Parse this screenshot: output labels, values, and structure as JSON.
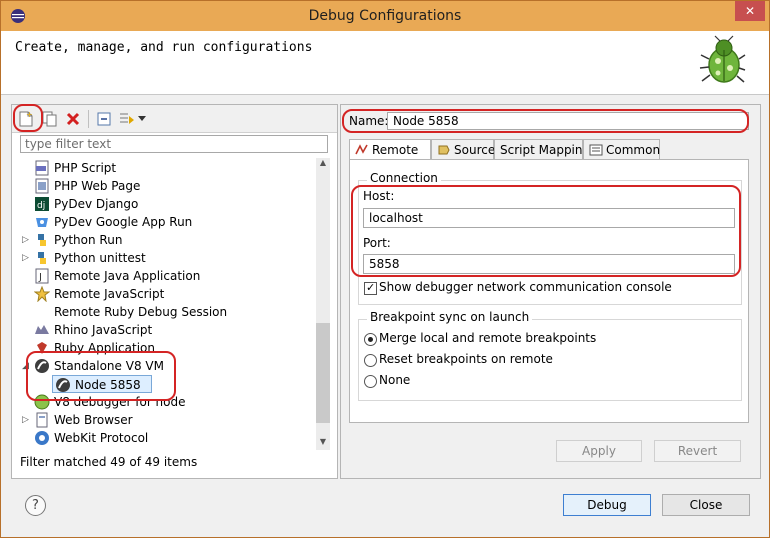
{
  "window": {
    "title": "Debug Configurations",
    "close_glyph": "✕"
  },
  "header": {
    "text": "Create, manage, and run configurations",
    "icon": "bug-icon"
  },
  "toolbar": {
    "buttons": [
      "new-configuration-icon",
      "duplicate-icon",
      "delete-icon",
      "collapse-all-icon",
      "filter-icon",
      "dropdown-icon"
    ]
  },
  "filter": {
    "placeholder": "type filter text"
  },
  "tree": {
    "items": [
      {
        "label": "PHP Script",
        "icon": "php-icon"
      },
      {
        "label": "PHP Web Page",
        "icon": "php-page-icon"
      },
      {
        "label": "PyDev Django",
        "icon": "django-icon"
      },
      {
        "label": "PyDev Google App Run",
        "icon": "gae-icon"
      },
      {
        "label": "Python Run",
        "icon": "python-icon"
      },
      {
        "label": "Python unittest",
        "icon": "python-icon"
      },
      {
        "label": "Remote Java Application",
        "icon": "java-icon"
      },
      {
        "label": "Remote JavaScript",
        "icon": "js-icon"
      },
      {
        "label": "Remote Ruby Debug Session",
        "icon": "ruby-icon"
      },
      {
        "label": "Rhino JavaScript",
        "icon": "rhino-icon"
      },
      {
        "label": "Ruby Application",
        "icon": "ruby-icon"
      },
      {
        "label": "Standalone V8 VM",
        "icon": "v8-icon"
      },
      {
        "label": "Node 5858",
        "icon": "node-icon"
      },
      {
        "label": "V8 debugger for node",
        "icon": "v8-node-icon"
      },
      {
        "label": "Web Browser",
        "icon": "browser-icon"
      },
      {
        "label": "WebKit Protocol",
        "icon": "webkit-icon"
      }
    ]
  },
  "status": "Filter matched 49 of 49 items",
  "name": {
    "label": "Name:",
    "value": "Node 5858"
  },
  "tabs": [
    "Remote",
    "Source",
    "Script Mapping",
    "Common"
  ],
  "connection": {
    "title": "Connection",
    "host_label": "Host:",
    "host_value": "localhost",
    "port_label": "Port:",
    "port_value": "5858",
    "console_label": "Show debugger network communication console"
  },
  "breakpoint": {
    "title": "Breakpoint sync on launch",
    "options": [
      "Merge local and remote breakpoints",
      "Reset breakpoints on remote",
      "None"
    ],
    "selected": "Merge local and remote breakpoints"
  },
  "buttons": {
    "apply": "Apply",
    "revert": "Revert",
    "debug": "Debug",
    "close": "Close",
    "help": "?"
  },
  "colors": {
    "title_bar": "#e9a955",
    "highlight": "#d42424"
  }
}
